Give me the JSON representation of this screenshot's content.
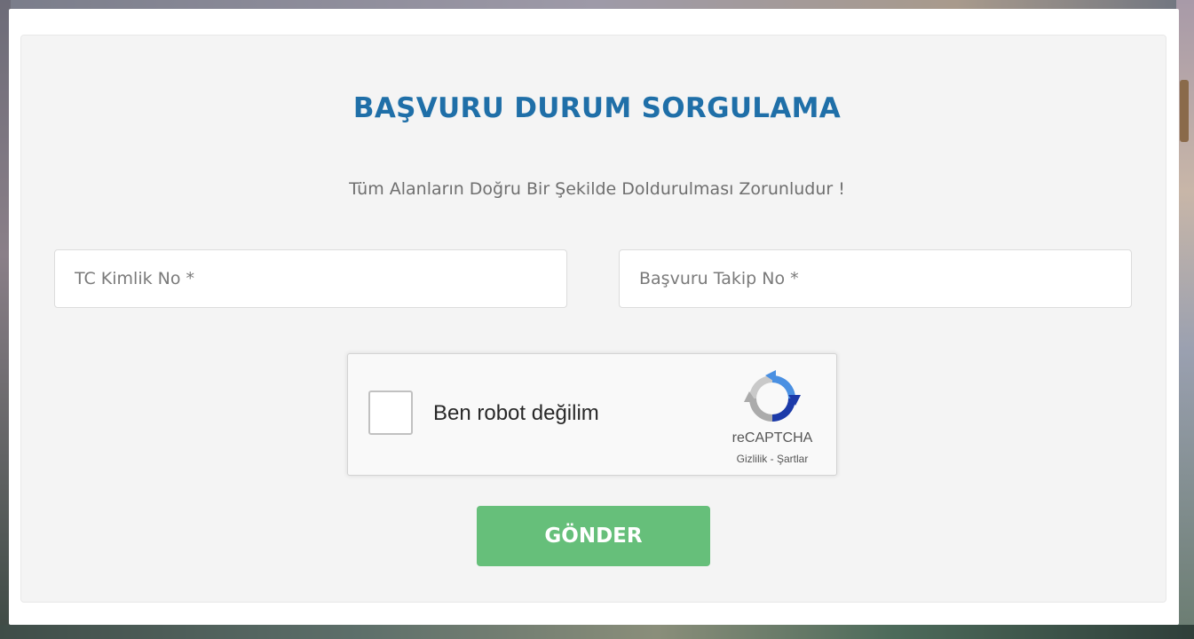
{
  "form": {
    "title": "BAŞVURU DURUM SORGULAMA",
    "subtitle": "Tüm Alanların Doğru Bir Şekilde Doldurulması Zorunludur !",
    "tc_field": {
      "value": "",
      "placeholder": "TC Kimlik No *"
    },
    "takip_field": {
      "value": "",
      "placeholder": "Başvuru Takip No *"
    },
    "submit_label": "GÖNDER"
  },
  "recaptcha": {
    "checkbox_label": "Ben robot değilim",
    "brand": "reCAPTCHA",
    "privacy_link": "Gizlilik",
    "separator": "-",
    "terms_link": "Şartlar",
    "checked": false,
    "icon": "recaptcha-logo-icon"
  },
  "colors": {
    "title": "#1f6fa8",
    "button": "#66bf7a",
    "panel": "#f4f4f4"
  }
}
